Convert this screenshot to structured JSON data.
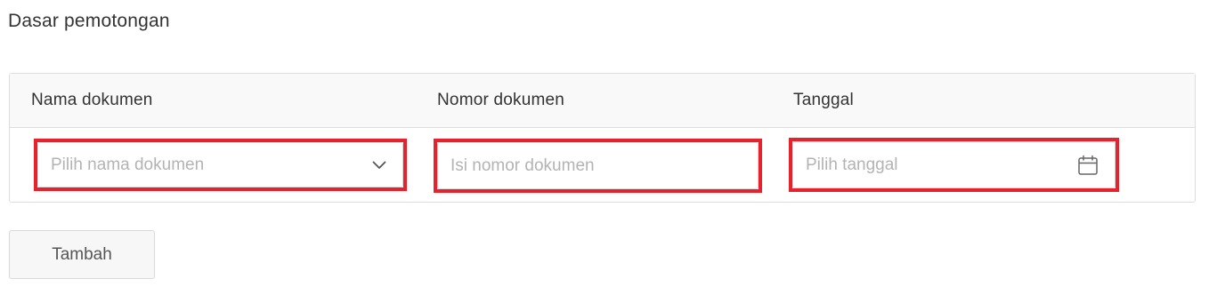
{
  "section": {
    "title": "Dasar pemotongan"
  },
  "table": {
    "headers": [
      "Nama dokumen",
      "Nomor dokumen",
      "Tanggal"
    ],
    "row": {
      "nama_dokumen": {
        "placeholder": "Pilih nama dokumen",
        "icon": "chevron-down-icon"
      },
      "nomor_dokumen": {
        "placeholder": "Isi nomor dokumen"
      },
      "tanggal": {
        "placeholder": "Pilih tanggal",
        "icon": "calendar-icon"
      }
    }
  },
  "actions": {
    "add_label": "Tambah"
  },
  "colors": {
    "highlight": "#e8222d",
    "border": "#dddddd",
    "header_bg": "#f9f9f9",
    "placeholder": "#b3b3b3"
  }
}
